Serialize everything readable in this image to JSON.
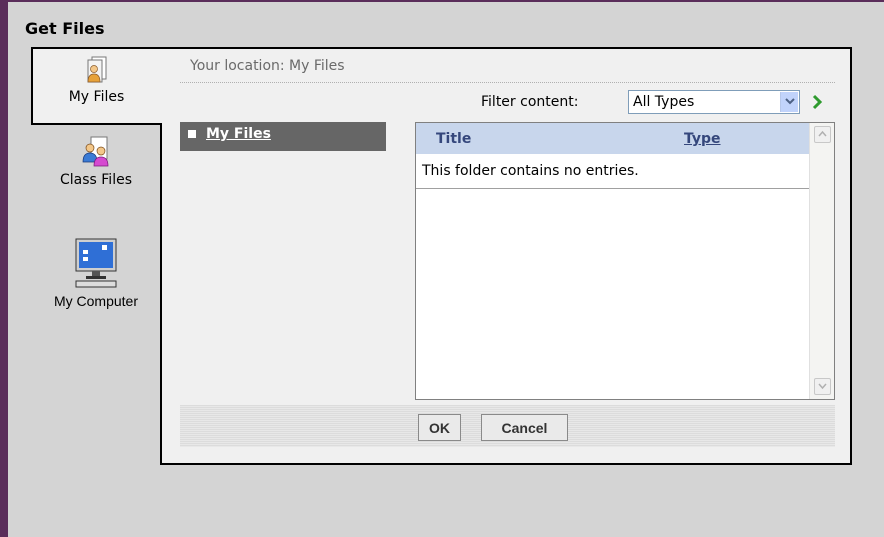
{
  "dialog": {
    "title": "Get Files"
  },
  "tabs": [
    {
      "label": "My Files",
      "icon": "my-files-icon",
      "active": true
    },
    {
      "label": "Class Files",
      "icon": "class-files-icon",
      "active": false
    },
    {
      "label": "My Computer",
      "icon": "my-computer-icon",
      "active": false
    }
  ],
  "location": {
    "text": "Your location: My Files"
  },
  "filter": {
    "label": "Filter content:",
    "selected": "All Types"
  },
  "tree": {
    "item_label": "My Files"
  },
  "table": {
    "headers": {
      "title": "Title",
      "type": "Type"
    },
    "empty_message": "This folder contains no entries."
  },
  "footer": {
    "ok_label": "OK",
    "cancel_label": "Cancel"
  },
  "colors": {
    "frame_border": "#5a2d5a",
    "tree_selected_bg": "#666666",
    "table_header_bg": "#c8d6ec",
    "header_text": "#35477c",
    "go_arrow": "#2e9a2e"
  }
}
